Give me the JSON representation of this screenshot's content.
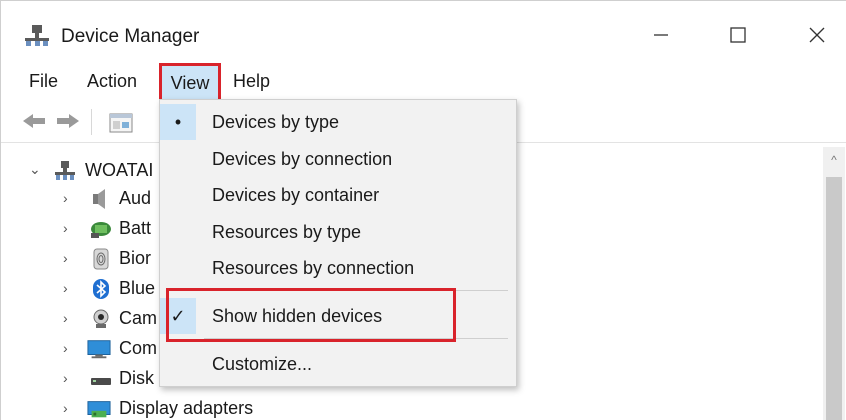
{
  "window": {
    "title": "Device Manager"
  },
  "menubar": {
    "file": "File",
    "action": "Action",
    "view": "View",
    "help": "Help"
  },
  "tree": {
    "root": "WOATAI",
    "items": [
      {
        "label": "Aud",
        "icon": "audio-icon"
      },
      {
        "label": "Batt",
        "icon": "battery-icon"
      },
      {
        "label": "Bior",
        "icon": "biometric-icon"
      },
      {
        "label": "Blue",
        "icon": "bluetooth-icon"
      },
      {
        "label": "Cam",
        "icon": "camera-icon"
      },
      {
        "label": "Com",
        "icon": "computer-icon"
      },
      {
        "label": "Disk",
        "icon": "disk-icon"
      },
      {
        "label": "Display adapters",
        "icon": "display-adapter-icon"
      }
    ]
  },
  "view_menu": {
    "items": [
      {
        "label": "Devices by type",
        "mark": "•"
      },
      {
        "label": "Devices by connection",
        "mark": ""
      },
      {
        "label": "Devices by container",
        "mark": ""
      },
      {
        "label": "Resources by type",
        "mark": ""
      },
      {
        "label": "Resources by connection",
        "mark": ""
      },
      {
        "label": "Show hidden devices",
        "mark": "✓"
      },
      {
        "label": "Customize...",
        "mark": ""
      }
    ]
  },
  "colors": {
    "highlight": "#d9232b",
    "menu_selected": "#cce4f7"
  }
}
